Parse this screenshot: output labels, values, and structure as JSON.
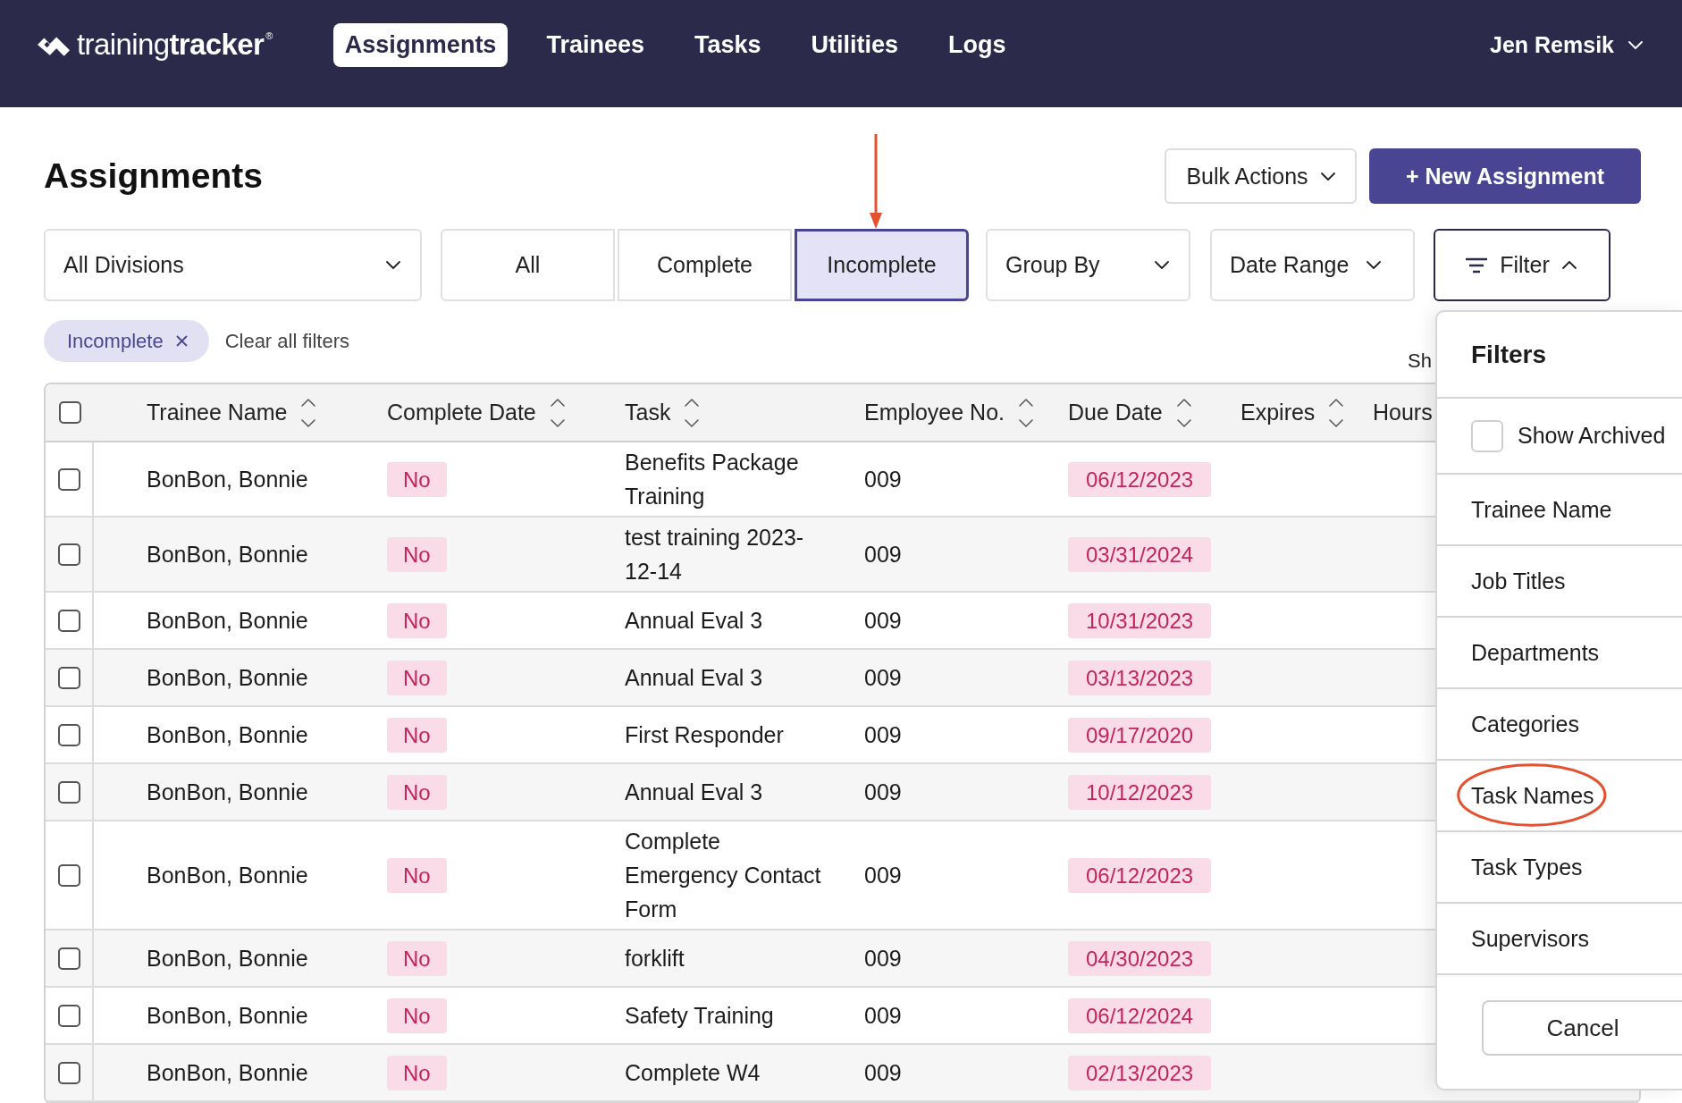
{
  "nav": {
    "logo": "training**tracker**$^{®}$",
    "items": [
      {
        "label": "Assignments",
        "selected": true
      },
      {
        "label": "Trainees",
        "selected": false
      },
      {
        "label": "Tasks",
        "selected": false
      },
      {
        "label": "Utilities",
        "selected": false
      },
      {
        "label": "Logs",
        "selected": false
      }
    ],
    "user": "Jen Remsik"
  },
  "header": {
    "title": "Assignments",
    "actions": [
      {
        "kind": "dropdown",
        "label": "Bulk Actions"
      },
      {
        "kind": "primary",
        "label": "+ New Assignment"
      }
    ]
  },
  "toolbar": {
    "division": "All Divisions",
    "status_tabs": [
      {
        "label": "All",
        "selected": false,
        "annotated": false
      },
      {
        "label": "Complete",
        "selected": false,
        "annotated": false
      },
      {
        "label": "Incomplete",
        "selected": true,
        "annotated": true
      }
    ],
    "group_by": "Group By",
    "date_range": "Date Range",
    "filter": {
      "label": "Filter",
      "expanded": true
    }
  },
  "active_filters": {
    "chips": [
      "Incomplete"
    ],
    "clear_label": "Clear all filters",
    "summary": "Sh"
  },
  "table": {
    "select_all_checked": false,
    "columns": [
      {
        "label": "Trainee Name",
        "sortable": true
      },
      {
        "label": "Complete Date",
        "sortable": true
      },
      {
        "label": "Task",
        "sortable": true
      },
      {
        "label": "Employee No.",
        "sortable": true
      },
      {
        "label": "Due Date",
        "sortable": true
      },
      {
        "label": "Expires",
        "sortable": true
      },
      {
        "label": "Hours",
        "sortable": false
      }
    ],
    "rows": [
      {
        "checked": false,
        "trainee": "BonBon, Bonnie",
        "complete": "No",
        "task": "Benefits Package Training",
        "employee_no": "009",
        "due_date": "06/12/2023"
      },
      {
        "checked": false,
        "trainee": "BonBon, Bonnie",
        "complete": "No",
        "task": "test training 2023-12-14",
        "employee_no": "009",
        "due_date": "03/31/2024"
      },
      {
        "checked": false,
        "trainee": "BonBon, Bonnie",
        "complete": "No",
        "task": "Annual Eval 3",
        "employee_no": "009",
        "due_date": "10/31/2023"
      },
      {
        "checked": false,
        "trainee": "BonBon, Bonnie",
        "complete": "No",
        "task": "Annual Eval 3",
        "employee_no": "009",
        "due_date": "03/13/2023"
      },
      {
        "checked": false,
        "trainee": "BonBon, Bonnie",
        "complete": "No",
        "task": "First Responder",
        "employee_no": "009",
        "due_date": "09/17/2020"
      },
      {
        "checked": false,
        "trainee": "BonBon, Bonnie",
        "complete": "No",
        "task": "Annual Eval 3",
        "employee_no": "009",
        "due_date": "10/12/2023"
      },
      {
        "checked": false,
        "trainee": "BonBon, Bonnie",
        "complete": "No",
        "task": "Complete Emergency Contact Form",
        "employee_no": "009",
        "due_date": "06/12/2023"
      },
      {
        "checked": false,
        "trainee": "BonBon, Bonnie",
        "complete": "No",
        "task": "forklift",
        "employee_no": "009",
        "due_date": "04/30/2023"
      },
      {
        "checked": false,
        "trainee": "BonBon, Bonnie",
        "complete": "No",
        "task": "Safety Training",
        "employee_no": "009",
        "due_date": "06/12/2024"
      },
      {
        "checked": false,
        "trainee": "BonBon, Bonnie",
        "complete": "No",
        "task": "Complete W4",
        "employee_no": "009",
        "due_date": "02/13/2023"
      }
    ]
  },
  "filter_panel": {
    "title": "Filters",
    "show_archived": {
      "label": "Show Archived",
      "checked": false
    },
    "options": [
      {
        "label": "Trainee Name",
        "annotated": false
      },
      {
        "label": "Job Titles",
        "annotated": false
      },
      {
        "label": "Departments",
        "annotated": false
      },
      {
        "label": "Categories",
        "annotated": false
      },
      {
        "label": "Task Names",
        "annotated": true
      },
      {
        "label": "Task Types",
        "annotated": false
      },
      {
        "label": "Supervisors",
        "annotated": false
      }
    ],
    "cancel": "Cancel"
  }
}
